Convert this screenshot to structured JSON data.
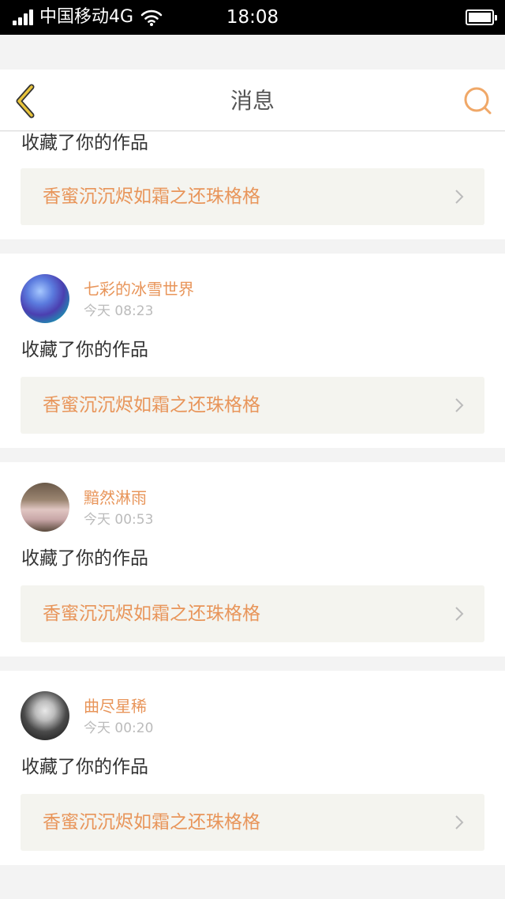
{
  "status_bar": {
    "carrier": "中国移动4G",
    "time": "18:08"
  },
  "nav": {
    "title": "消息",
    "back_icon": "chevron-left-icon",
    "search_icon": "search-icon"
  },
  "colors": {
    "accent": "#e8955a",
    "back_icon": "#d9b435",
    "link_bg": "#f4f4ef"
  },
  "messages": [
    {
      "action": "收藏了你的作品",
      "work_title": "香蜜沉沉烬如霜之还珠格格"
    },
    {
      "username": "七彩的冰雪世界",
      "time": "今天 08:23",
      "action": "收藏了你的作品",
      "work_title": "香蜜沉沉烬如霜之还珠格格"
    },
    {
      "username": "黯然淋雨",
      "time": "今天 00:53",
      "action": "收藏了你的作品",
      "work_title": "香蜜沉沉烬如霜之还珠格格"
    },
    {
      "username": "曲尽星稀",
      "time": "今天 00:20",
      "action": "收藏了你的作品",
      "work_title": "香蜜沉沉烬如霜之还珠格格"
    }
  ]
}
